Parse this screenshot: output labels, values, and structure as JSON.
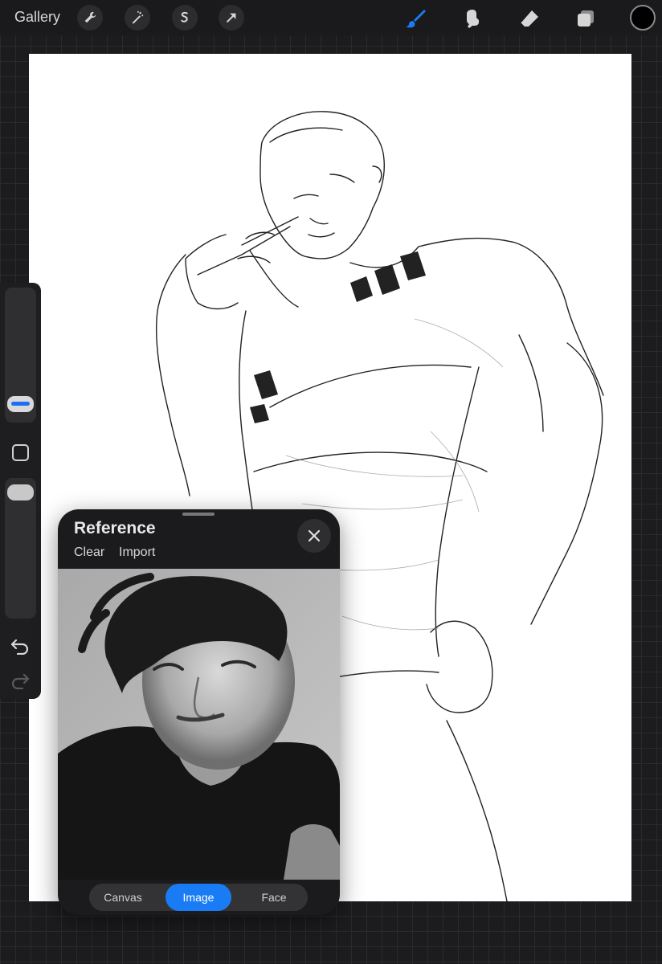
{
  "toolbar": {
    "gallery_label": "Gallery",
    "left_tools": [
      "wrench-icon",
      "magic-wand-icon",
      "selection-icon",
      "transform-arrow-icon"
    ],
    "right_tools": [
      "brush-icon",
      "smudge-icon",
      "eraser-icon",
      "layers-icon"
    ],
    "active_tool": "brush-icon",
    "accent_color": "#1a7cf5",
    "current_color": "#000000"
  },
  "reference": {
    "title": "Reference",
    "clear_label": "Clear",
    "import_label": "Import",
    "tabs": [
      {
        "label": "Canvas"
      },
      {
        "label": "Image"
      },
      {
        "label": "Face"
      }
    ],
    "active_tab": "Image"
  }
}
